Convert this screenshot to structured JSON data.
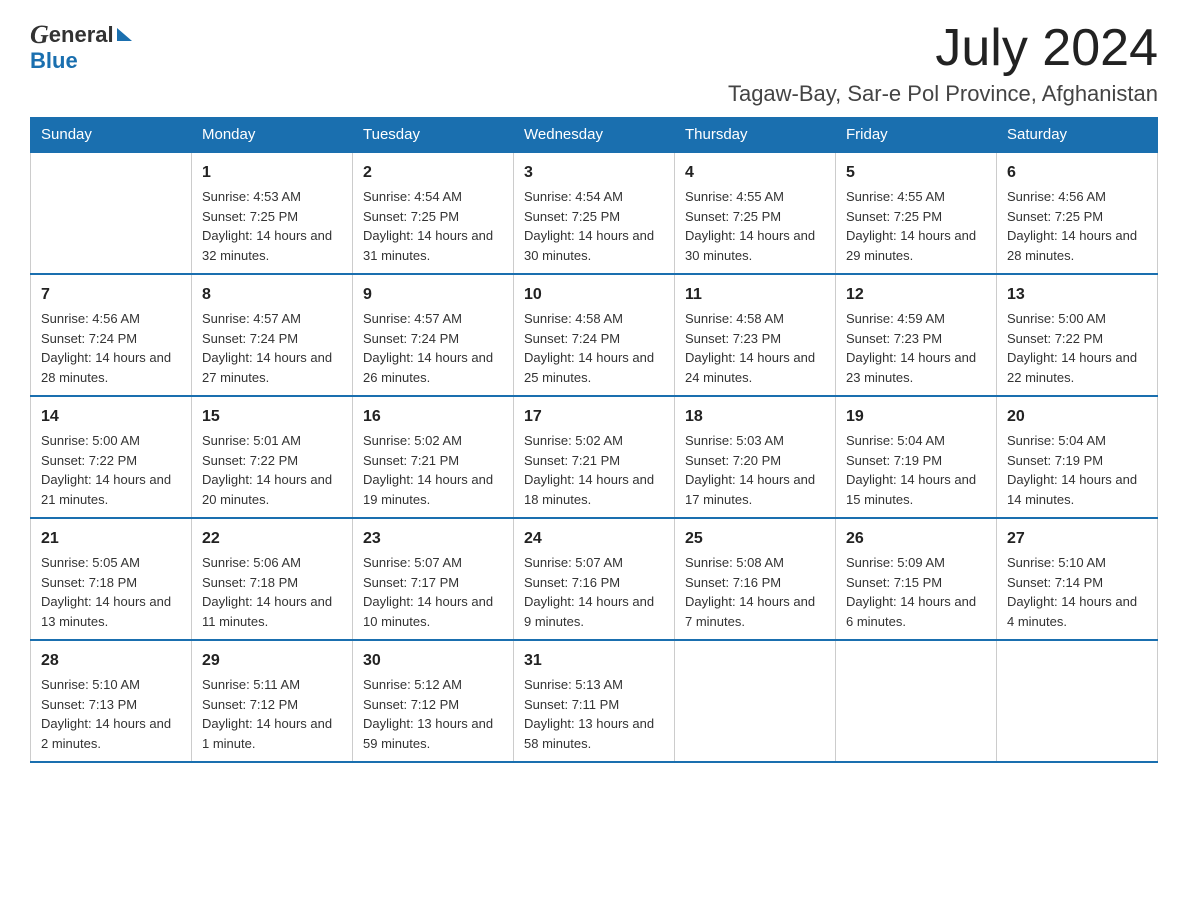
{
  "header": {
    "month_title": "July 2024",
    "location": "Tagaw-Bay, Sar-e Pol Province, Afghanistan",
    "logo_general": "General",
    "logo_blue": "Blue"
  },
  "calendar": {
    "days_of_week": [
      "Sunday",
      "Monday",
      "Tuesday",
      "Wednesday",
      "Thursday",
      "Friday",
      "Saturday"
    ],
    "weeks": [
      [
        {
          "day": "",
          "sunrise": "",
          "sunset": "",
          "daylight": ""
        },
        {
          "day": "1",
          "sunrise": "Sunrise: 4:53 AM",
          "sunset": "Sunset: 7:25 PM",
          "daylight": "Daylight: 14 hours and 32 minutes."
        },
        {
          "day": "2",
          "sunrise": "Sunrise: 4:54 AM",
          "sunset": "Sunset: 7:25 PM",
          "daylight": "Daylight: 14 hours and 31 minutes."
        },
        {
          "day": "3",
          "sunrise": "Sunrise: 4:54 AM",
          "sunset": "Sunset: 7:25 PM",
          "daylight": "Daylight: 14 hours and 30 minutes."
        },
        {
          "day": "4",
          "sunrise": "Sunrise: 4:55 AM",
          "sunset": "Sunset: 7:25 PM",
          "daylight": "Daylight: 14 hours and 30 minutes."
        },
        {
          "day": "5",
          "sunrise": "Sunrise: 4:55 AM",
          "sunset": "Sunset: 7:25 PM",
          "daylight": "Daylight: 14 hours and 29 minutes."
        },
        {
          "day": "6",
          "sunrise": "Sunrise: 4:56 AM",
          "sunset": "Sunset: 7:25 PM",
          "daylight": "Daylight: 14 hours and 28 minutes."
        }
      ],
      [
        {
          "day": "7",
          "sunrise": "Sunrise: 4:56 AM",
          "sunset": "Sunset: 7:24 PM",
          "daylight": "Daylight: 14 hours and 28 minutes."
        },
        {
          "day": "8",
          "sunrise": "Sunrise: 4:57 AM",
          "sunset": "Sunset: 7:24 PM",
          "daylight": "Daylight: 14 hours and 27 minutes."
        },
        {
          "day": "9",
          "sunrise": "Sunrise: 4:57 AM",
          "sunset": "Sunset: 7:24 PM",
          "daylight": "Daylight: 14 hours and 26 minutes."
        },
        {
          "day": "10",
          "sunrise": "Sunrise: 4:58 AM",
          "sunset": "Sunset: 7:24 PM",
          "daylight": "Daylight: 14 hours and 25 minutes."
        },
        {
          "day": "11",
          "sunrise": "Sunrise: 4:58 AM",
          "sunset": "Sunset: 7:23 PM",
          "daylight": "Daylight: 14 hours and 24 minutes."
        },
        {
          "day": "12",
          "sunrise": "Sunrise: 4:59 AM",
          "sunset": "Sunset: 7:23 PM",
          "daylight": "Daylight: 14 hours and 23 minutes."
        },
        {
          "day": "13",
          "sunrise": "Sunrise: 5:00 AM",
          "sunset": "Sunset: 7:22 PM",
          "daylight": "Daylight: 14 hours and 22 minutes."
        }
      ],
      [
        {
          "day": "14",
          "sunrise": "Sunrise: 5:00 AM",
          "sunset": "Sunset: 7:22 PM",
          "daylight": "Daylight: 14 hours and 21 minutes."
        },
        {
          "day": "15",
          "sunrise": "Sunrise: 5:01 AM",
          "sunset": "Sunset: 7:22 PM",
          "daylight": "Daylight: 14 hours and 20 minutes."
        },
        {
          "day": "16",
          "sunrise": "Sunrise: 5:02 AM",
          "sunset": "Sunset: 7:21 PM",
          "daylight": "Daylight: 14 hours and 19 minutes."
        },
        {
          "day": "17",
          "sunrise": "Sunrise: 5:02 AM",
          "sunset": "Sunset: 7:21 PM",
          "daylight": "Daylight: 14 hours and 18 minutes."
        },
        {
          "day": "18",
          "sunrise": "Sunrise: 5:03 AM",
          "sunset": "Sunset: 7:20 PM",
          "daylight": "Daylight: 14 hours and 17 minutes."
        },
        {
          "day": "19",
          "sunrise": "Sunrise: 5:04 AM",
          "sunset": "Sunset: 7:19 PM",
          "daylight": "Daylight: 14 hours and 15 minutes."
        },
        {
          "day": "20",
          "sunrise": "Sunrise: 5:04 AM",
          "sunset": "Sunset: 7:19 PM",
          "daylight": "Daylight: 14 hours and 14 minutes."
        }
      ],
      [
        {
          "day": "21",
          "sunrise": "Sunrise: 5:05 AM",
          "sunset": "Sunset: 7:18 PM",
          "daylight": "Daylight: 14 hours and 13 minutes."
        },
        {
          "day": "22",
          "sunrise": "Sunrise: 5:06 AM",
          "sunset": "Sunset: 7:18 PM",
          "daylight": "Daylight: 14 hours and 11 minutes."
        },
        {
          "day": "23",
          "sunrise": "Sunrise: 5:07 AM",
          "sunset": "Sunset: 7:17 PM",
          "daylight": "Daylight: 14 hours and 10 minutes."
        },
        {
          "day": "24",
          "sunrise": "Sunrise: 5:07 AM",
          "sunset": "Sunset: 7:16 PM",
          "daylight": "Daylight: 14 hours and 9 minutes."
        },
        {
          "day": "25",
          "sunrise": "Sunrise: 5:08 AM",
          "sunset": "Sunset: 7:16 PM",
          "daylight": "Daylight: 14 hours and 7 minutes."
        },
        {
          "day": "26",
          "sunrise": "Sunrise: 5:09 AM",
          "sunset": "Sunset: 7:15 PM",
          "daylight": "Daylight: 14 hours and 6 minutes."
        },
        {
          "day": "27",
          "sunrise": "Sunrise: 5:10 AM",
          "sunset": "Sunset: 7:14 PM",
          "daylight": "Daylight: 14 hours and 4 minutes."
        }
      ],
      [
        {
          "day": "28",
          "sunrise": "Sunrise: 5:10 AM",
          "sunset": "Sunset: 7:13 PM",
          "daylight": "Daylight: 14 hours and 2 minutes."
        },
        {
          "day": "29",
          "sunrise": "Sunrise: 5:11 AM",
          "sunset": "Sunset: 7:12 PM",
          "daylight": "Daylight: 14 hours and 1 minute."
        },
        {
          "day": "30",
          "sunrise": "Sunrise: 5:12 AM",
          "sunset": "Sunset: 7:12 PM",
          "daylight": "Daylight: 13 hours and 59 minutes."
        },
        {
          "day": "31",
          "sunrise": "Sunrise: 5:13 AM",
          "sunset": "Sunset: 7:11 PM",
          "daylight": "Daylight: 13 hours and 58 minutes."
        },
        {
          "day": "",
          "sunrise": "",
          "sunset": "",
          "daylight": ""
        },
        {
          "day": "",
          "sunrise": "",
          "sunset": "",
          "daylight": ""
        },
        {
          "day": "",
          "sunrise": "",
          "sunset": "",
          "daylight": ""
        }
      ]
    ]
  }
}
